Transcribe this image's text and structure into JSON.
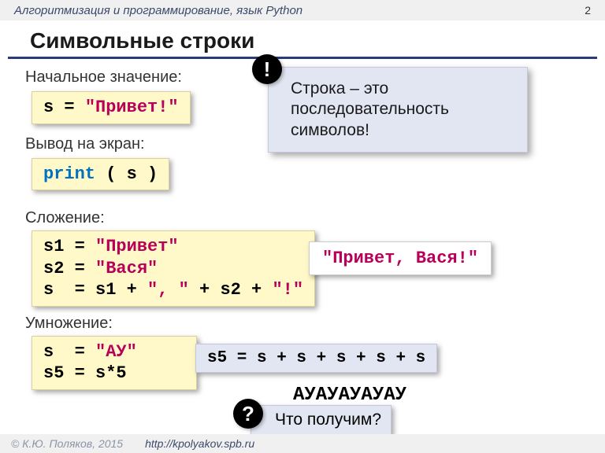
{
  "header": {
    "subject": "Алгоритмизация и программирование, язык Python",
    "page": "2"
  },
  "title": "Символьные строки",
  "sections": {
    "init": {
      "label": "Начальное значение:",
      "code_pre": "s = ",
      "code_str": "\"Привет!\""
    },
    "print": {
      "label": "Вывод на экран:",
      "code_kw": "print",
      "code_rest": " ( s )"
    },
    "add": {
      "label": "Сложение:",
      "l1a": "s1 = ",
      "l1b": "\"Привет\"",
      "l2a": "s2 = ",
      "l2b": "\"Вася\"",
      "l3a": "s  = s1 + ",
      "l3b": "\", \"",
      "l3c": " + s2 + ",
      "l3d": "\"!\""
    },
    "mul": {
      "label": "Умножение:",
      "l1a": "s  = ",
      "l1b": "\"АУ\"",
      "l2": "s5 = s*5"
    }
  },
  "note": {
    "marker": "!",
    "text": "Строка – это последовательность символов!"
  },
  "result_add": "\"Привет, Вася!\"",
  "expr": "s5 = s + s + s + s + s",
  "repeat": "АУАУАУАУАУ",
  "question": {
    "marker": "?",
    "text": "Что получим?"
  },
  "footer": {
    "copyright": "© К.Ю. Поляков, 2015",
    "url": "http://kpolyakov.spb.ru"
  }
}
